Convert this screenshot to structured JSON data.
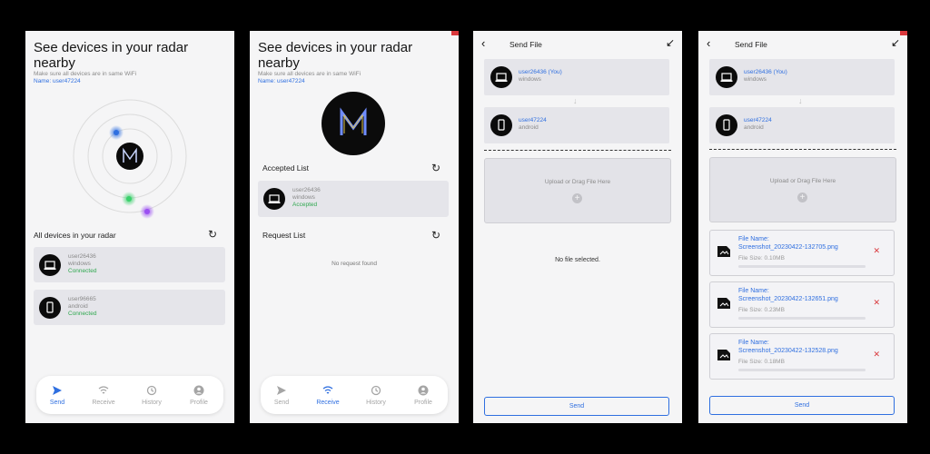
{
  "radar_screen": {
    "title": "See devices in your radar nearby",
    "subtitle": "Make sure all devices are in same WiFi",
    "name": "Name: user47224",
    "section": "All devices in your radar",
    "devices": [
      {
        "user": "user26436",
        "os": "windows",
        "status": "Connected",
        "icon": "laptop-icon"
      },
      {
        "user": "user96665",
        "os": "android",
        "status": "Connected",
        "icon": "phone-icon"
      }
    ]
  },
  "receive_screen": {
    "title": "See devices in your radar nearby",
    "subtitle": "Make sure all devices are in same WiFi",
    "name": "Name: user47224",
    "accepted_title": "Accepted List",
    "accepted": [
      {
        "user": "user26436",
        "os": "windows",
        "status": "Accepted",
        "icon": "laptop-icon"
      }
    ],
    "request_title": "Request List",
    "empty_requests": "No request found"
  },
  "nav": {
    "items": [
      {
        "label": "Send",
        "icon": "send-icon"
      },
      {
        "label": "Receive",
        "icon": "wifi-icon"
      },
      {
        "label": "History",
        "icon": "history-icon"
      },
      {
        "label": "Profile",
        "icon": "profile-icon"
      }
    ]
  },
  "send_screen": {
    "header_title": "Send File",
    "sender": {
      "user": "user26436 (You)",
      "os": "windows"
    },
    "receiver": {
      "user": "user47224",
      "os": "android"
    },
    "upload_text": "Upload or Drag File Here",
    "no_file": "No file selected.",
    "send_label": "Send"
  },
  "send_files_screen": {
    "header_title": "Send File",
    "sender": {
      "user": "user26436 (You)",
      "os": "windows"
    },
    "receiver": {
      "user": "user47224",
      "os": "android"
    },
    "upload_text": "Upload or Drag File Here",
    "send_label": "Send",
    "files": [
      {
        "name_label": "File Name:",
        "name": "Screenshot_20230422-132705.png",
        "size": "File Size: 0.10MB"
      },
      {
        "name_label": "File Name:",
        "name": "Screenshot_20230422-132651.png",
        "size": "File Size: 0.23MB"
      },
      {
        "name_label": "File Name:",
        "name": "Screenshot_20230422-132528.png",
        "size": "File Size: 0.18MB"
      }
    ]
  },
  "colors": {
    "accent": "#2f6fe0",
    "connected": "#2fa84f",
    "remove": "#d9383c",
    "background": "#000000"
  }
}
